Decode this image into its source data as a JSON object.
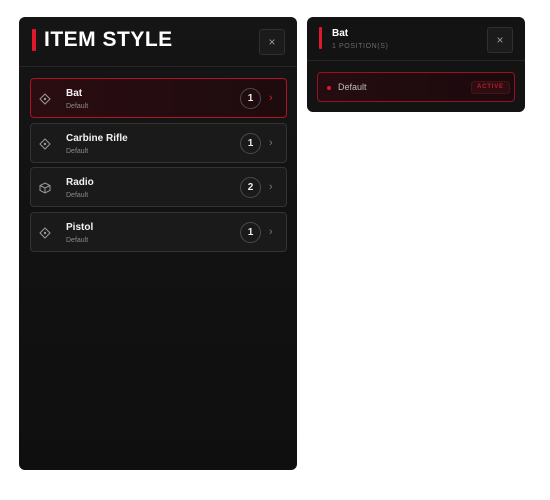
{
  "main_panel": {
    "title": "ITEM STYLE",
    "close_label": "×",
    "items": [
      {
        "name": "Bat",
        "style": "Default",
        "count": "1",
        "icon": "diamond-target-icon",
        "selected": true
      },
      {
        "name": "Carbine Rifle",
        "style": "Default",
        "count": "1",
        "icon": "diamond-target-icon",
        "selected": false
      },
      {
        "name": "Radio",
        "style": "Default",
        "count": "2",
        "icon": "cube-icon",
        "selected": false
      },
      {
        "name": "Pistol",
        "style": "Default",
        "count": "1",
        "icon": "diamond-target-icon",
        "selected": false
      }
    ],
    "chevron": "›"
  },
  "detail_panel": {
    "title": "Bat",
    "subtitle": "1 POSITION(S)",
    "close_label": "×",
    "options": [
      {
        "label": "Default",
        "badge": "ACTIVE"
      }
    ]
  },
  "colors": {
    "accent": "#e0182d",
    "panel_bg": "#131313",
    "item_bg": "#1a1a1b",
    "selected_bg": "#2a0d11",
    "border": "#333333",
    "page_bg": "#ffffff"
  }
}
